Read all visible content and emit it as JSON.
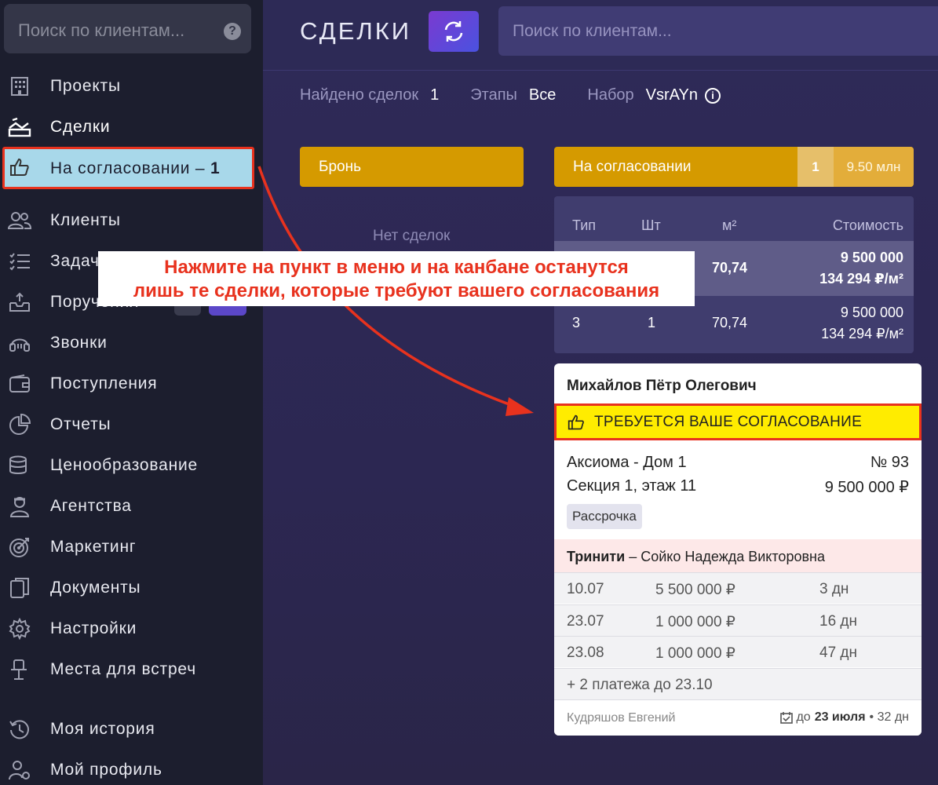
{
  "sidebar": {
    "search_placeholder": "Поиск по клиентам...",
    "help_icon": "?",
    "items": [
      {
        "label": "Проекты",
        "icon": "building-icon"
      },
      {
        "label": "Сделки",
        "icon": "deals-icon"
      },
      {
        "label": "Клиенты",
        "icon": "users-icon"
      },
      {
        "label": "Задачи",
        "icon": "tasks-icon"
      },
      {
        "label": "Поручения",
        "icon": "inbox-upload-icon"
      },
      {
        "label": "Звонки",
        "icon": "headset-icon"
      },
      {
        "label": "Поступления",
        "icon": "wallet-icon"
      },
      {
        "label": "Отчеты",
        "icon": "pie-chart-icon"
      },
      {
        "label": "Ценообразование",
        "icon": "coins-icon"
      },
      {
        "label": "Агентства",
        "icon": "agent-icon"
      },
      {
        "label": "Маркетинг",
        "icon": "target-icon"
      },
      {
        "label": "Документы",
        "icon": "documents-icon"
      },
      {
        "label": "Настройки",
        "icon": "gear-icon"
      },
      {
        "label": "Места для встреч",
        "icon": "meeting-place-icon"
      },
      {
        "label": "Моя история",
        "icon": "history-icon"
      },
      {
        "label": "Мой профиль",
        "icon": "profile-gear-icon"
      }
    ],
    "approval_item": {
      "label": "На согласовании – ",
      "count": "1",
      "icon": "thumbs-up-icon"
    }
  },
  "header": {
    "title": "СДЕЛКИ",
    "search_placeholder": "Поиск по клиентам...",
    "refresh_icon": "refresh-icon"
  },
  "filters": {
    "found_label": "Найдено сделок",
    "found_value": "1",
    "stages_label": "Этапы",
    "stages_value": "Все",
    "set_label": "Набор",
    "set_value": "VsrAYn",
    "info_icon": "i"
  },
  "columns": {
    "bron": {
      "title": "Бронь",
      "empty_text": "Нет сделок"
    },
    "approval": {
      "title": "На согласовании",
      "count": "1",
      "sum": "9.50 млн"
    }
  },
  "table": {
    "headers": [
      "Тип",
      "Шт",
      "м²",
      "Стоимость"
    ],
    "rows": [
      {
        "type": "",
        "qty": "",
        "area": "70,74",
        "cost": "9 500 000",
        "per_m": "134 294 ₽/м²"
      },
      {
        "type": "3",
        "qty": "1",
        "area": "70,74",
        "cost": "9 500 000",
        "per_m": "134 294 ₽/м²"
      }
    ]
  },
  "card": {
    "client": "Михайлов Пётр Олегович",
    "requirement": "ТРЕБУЕТСЯ ВАШЕ СОГЛАСОВАНИЕ",
    "project": "Аксиома - Дом 1",
    "number": "№ 93",
    "section": "Секция 1, этаж 11",
    "price": "9 500 000 ₽",
    "tag": "Рассрочка",
    "agency_name": "Тринити",
    "agency_sep": " – ",
    "agent": "Сойко Надежда Викторовна",
    "payments": [
      {
        "date": "10.07",
        "amount": "5 500 000 ₽",
        "days": "3 дн"
      },
      {
        "date": "23.07",
        "amount": "1 000 000 ₽",
        "days": "16 дн"
      },
      {
        "date": "23.08",
        "amount": "1 000 000 ₽",
        "days": "47 дн"
      }
    ],
    "more_payments": "+ 2 платежа до 23.10",
    "manager": "Кудряшов Евгений",
    "due_prefix": "до",
    "due_date": "23 июля",
    "due_days": "• 32 дн"
  },
  "annotation": {
    "line1": "Нажмите на пункт в меню и на канбане останутся",
    "line2": "лишь те сделки, которые требуют вашего согласования"
  },
  "colors": {
    "sidebar_bg": "#1c1e2e",
    "accent_gold": "#d59a00",
    "highlight_red": "#e8321e",
    "highlight_yellow": "#ffec00",
    "approval_bg": "#a8d8ea"
  }
}
